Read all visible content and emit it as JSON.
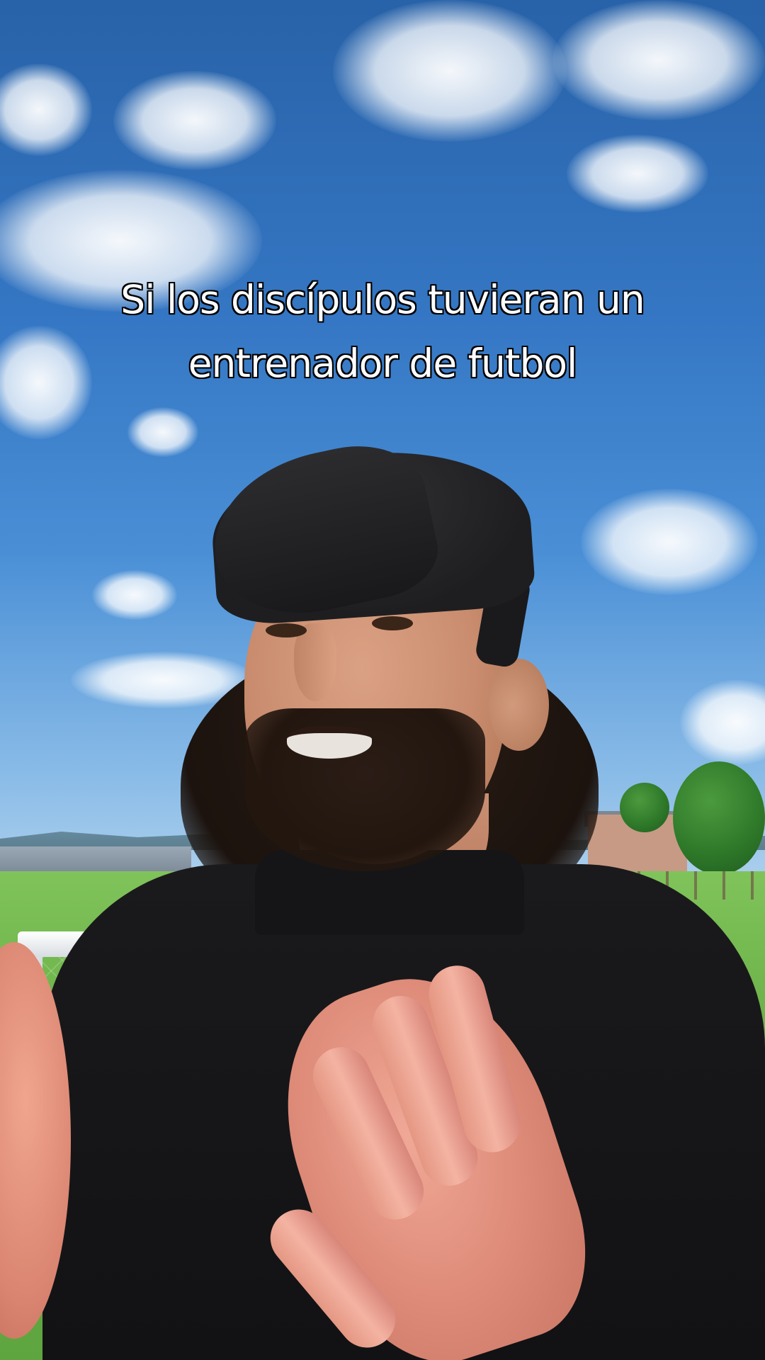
{
  "caption": {
    "line1": "Si los discípulos tuvieran un",
    "line2": "entrenador de futbol"
  },
  "colors": {
    "caption_text": "#ffffff",
    "caption_outline": "#000000",
    "sky": "#3577c4",
    "grass": "#6db24a",
    "shirt": "#141416"
  }
}
